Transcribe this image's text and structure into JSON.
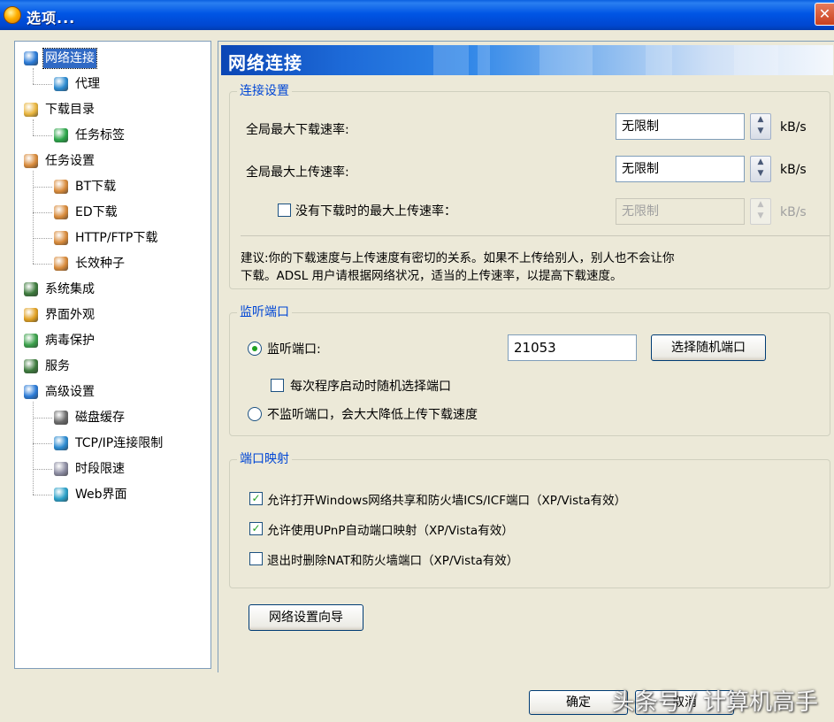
{
  "window": {
    "title": "选项..."
  },
  "tree": {
    "items": [
      {
        "label": "网络连接",
        "color": "#2a7ad6"
      },
      {
        "label": "代理",
        "color": "#2b8ad0"
      },
      {
        "label": "下载目录",
        "color": "#e8b43c"
      },
      {
        "label": "任务标签",
        "color": "#2aa548"
      },
      {
        "label": "任务设置",
        "color": "#d88a3a"
      },
      {
        "label": "BT下载",
        "color": "#d88a3a"
      },
      {
        "label": "ED下载",
        "color": "#d88a3a"
      },
      {
        "label": "HTTP/FTP下载",
        "color": "#d88a3a"
      },
      {
        "label": "长效种子",
        "color": "#d88a3a"
      },
      {
        "label": "系统集成",
        "color": "#3c7a3c"
      },
      {
        "label": "界面外观",
        "color": "#e0a020"
      },
      {
        "label": "病毒保护",
        "color": "#3aa04a"
      },
      {
        "label": "服务",
        "color": "#3c7a3c"
      },
      {
        "label": "高级设置",
        "color": "#2a7ad6"
      },
      {
        "label": "磁盘缓存",
        "color": "#6a6a6a"
      },
      {
        "label": "TCP/IP连接限制",
        "color": "#2a8ad0"
      },
      {
        "label": "时段限速",
        "color": "#8a8aa0"
      },
      {
        "label": "Web界面",
        "color": "#2aa0c8"
      }
    ]
  },
  "panel": {
    "title": "网络连接",
    "connection": {
      "legend": "连接设置",
      "max_download_label": "全局最大下载速率:",
      "max_download_value": "无限制",
      "max_upload_label": "全局最大上传速率:",
      "max_upload_value": "无限制",
      "idle_upload_label": "没有下载时的最大上传速率：",
      "idle_upload_value": "无限制",
      "unit": "kB/s",
      "advice_line1": "建议:你的下载速度与上传速度有密切的关系。如果不上传给别人，别人也不会让你",
      "advice_line2": "下载。ADSL 用户请根据网络状况，适当的上传速率，以提高下载速度。"
    },
    "listen": {
      "legend": "监听端口",
      "listen_label": "监听端口:",
      "port_value": "21053",
      "random_button": "选择随机端口",
      "random_each_start": "每次程序启动时随机选择端口",
      "no_listen": "不监听端口，会大大降低上传下载速度"
    },
    "mapping": {
      "legend": "端口映射",
      "opt1": "允许打开Windows网络共享和防火墙ICS/ICF端口（XP/Vista有效）",
      "opt2": "允许使用UPnP自动端口映射（XP/Vista有效）",
      "opt3": "退出时删除NAT和防火墙端口（XP/Vista有效）"
    },
    "wizard_button": "网络设置向导"
  },
  "footer": {
    "ok_button": "确定",
    "cancel_button": "取消",
    "watermark": "头条号 / 计算机高手"
  },
  "colors": {
    "accent": "#0046d5",
    "selection": "#316ac5",
    "check": "#21a121"
  }
}
